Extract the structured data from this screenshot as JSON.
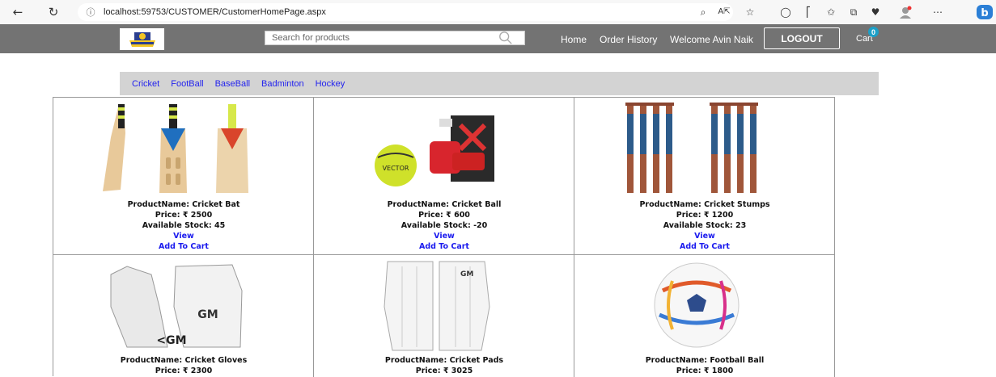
{
  "browser": {
    "url": "localhost:59753/CUSTOMER/CustomerHomePage.aspx",
    "icons": [
      "back-icon",
      "refresh-icon",
      "info-icon",
      "search-page-icon",
      "read-aloud-icon",
      "favorite-icon",
      "extensions-icon",
      "split-icon",
      "favorites-icon",
      "collections-icon",
      "browser-essentials-icon",
      "profile-icon",
      "more-icon",
      "bing-icon"
    ]
  },
  "header": {
    "search_placeholder": "Search for products",
    "home_label": "Home",
    "order_history_label": "Order History",
    "welcome_text": "Welcome Avin Naik",
    "logout_label": "LOGOUT",
    "cart_label": "Cart",
    "cart_count": "0"
  },
  "categories": [
    "Cricket",
    "FootBall",
    "BaseBall",
    "Badminton",
    "Hockey"
  ],
  "products": [
    {
      "name": "ProductName: Cricket Bat",
      "price": "Price: ₹ 2500",
      "stock": "Available Stock: 45",
      "view": "View",
      "add": "Add To Cart",
      "icon": "cricket-bat-image"
    },
    {
      "name": "ProductName: Cricket Ball",
      "price": "Price: ₹ 600",
      "stock": "Available Stock: -20",
      "view": "View",
      "add": "Add To Cart",
      "icon": "cricket-ball-image"
    },
    {
      "name": "ProductName: Cricket Stumps",
      "price": "Price: ₹ 1200",
      "stock": "Available Stock: 23",
      "view": "View",
      "add": "Add To Cart",
      "icon": "cricket-stumps-image"
    },
    {
      "name": "ProductName: Cricket Gloves",
      "price": "Price: ₹ 2300",
      "icon": "cricket-gloves-image"
    },
    {
      "name": "ProductName: Cricket Pads",
      "price": "Price: ₹ 3025",
      "icon": "cricket-pads-image"
    },
    {
      "name": "ProductName: Football Ball",
      "price": "Price: ₹ 1800",
      "icon": "football-image"
    }
  ],
  "colors": {
    "header_bg": "#737373",
    "category_bar_bg": "#d3d3d3",
    "link": "#1a1aee",
    "cart_badge": "#1ca0c8"
  }
}
